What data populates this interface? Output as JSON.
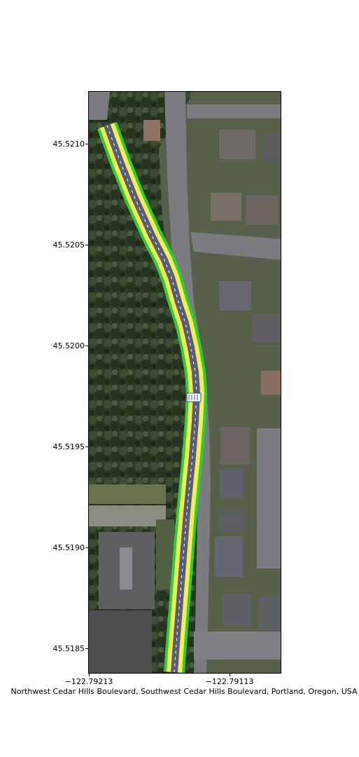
{
  "xlabel": "Northwest Cedar Hills Boulevard, Southwest Cedar Hills Boulevard, Portland, Oregon, USA",
  "yticks": [
    "45.5210",
    "45.5205",
    "45.5200",
    "45.5195",
    "45.5190",
    "45.5185"
  ],
  "xticks": [
    "−122.79213",
    "−122.79113"
  ],
  "colors": {
    "corridor_outer": "#33cc33",
    "corridor_inner": "#f0ee5a",
    "road_surface": "#5c5c72",
    "lane_marking": "#ffffff"
  }
}
